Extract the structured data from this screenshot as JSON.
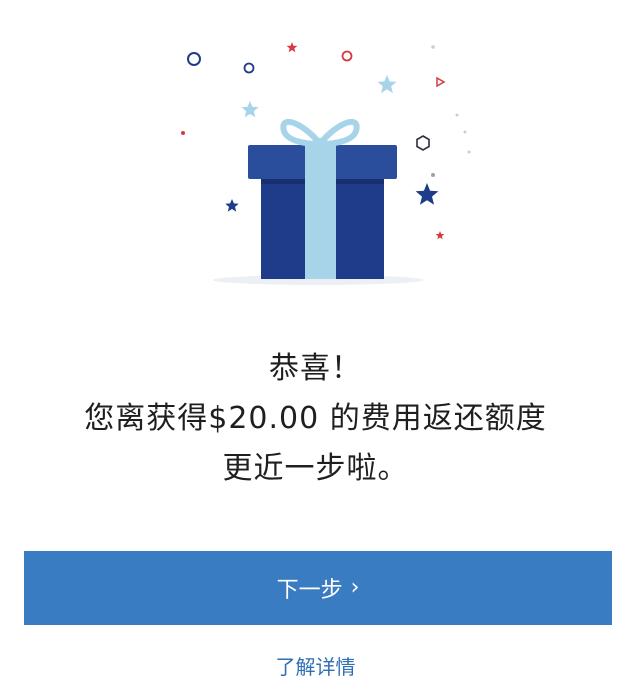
{
  "message": {
    "line1": "恭喜！",
    "line2": "您离获得$20.00 的费用返还额度",
    "line3": "更近一步啦。"
  },
  "next_button": {
    "label": "下一步",
    "chevron": "›"
  },
  "learn_more": {
    "label": "了解详情"
  },
  "illustration": {
    "icon": "gift-box-icon",
    "colors": {
      "box_dark": "#1f3c8a",
      "box_lid": "#2a4d9c",
      "ribbon": "#a8d4ea",
      "star_blue": "#1f3c8a",
      "star_light": "#a8d4ea",
      "star_red": "#d9383f"
    }
  },
  "accent_color": "#3a7cc1"
}
